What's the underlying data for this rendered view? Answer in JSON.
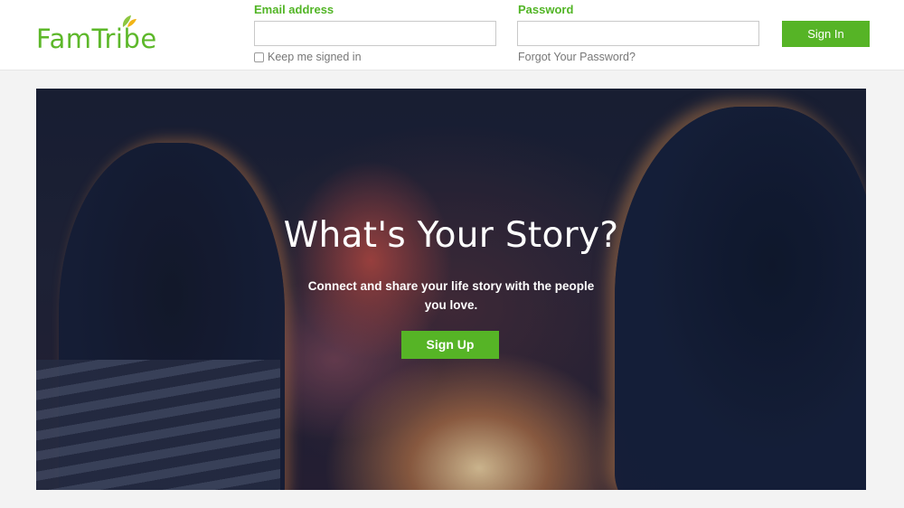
{
  "brand": {
    "name": "FamTribe",
    "accent_color": "#56b426",
    "icon": "leaf-icon"
  },
  "login": {
    "email_label": "Email address",
    "email_value": "",
    "password_label": "Password",
    "password_value": "",
    "keep_signed_in_label": "Keep me signed in",
    "keep_signed_in_checked": false,
    "forgot_password_label": "Forgot Your Password?",
    "signin_label": "Sign In"
  },
  "hero": {
    "title": "What's Your Story?",
    "subtitle": "Connect and share your life story with the people you love.",
    "signup_label": "Sign Up"
  }
}
